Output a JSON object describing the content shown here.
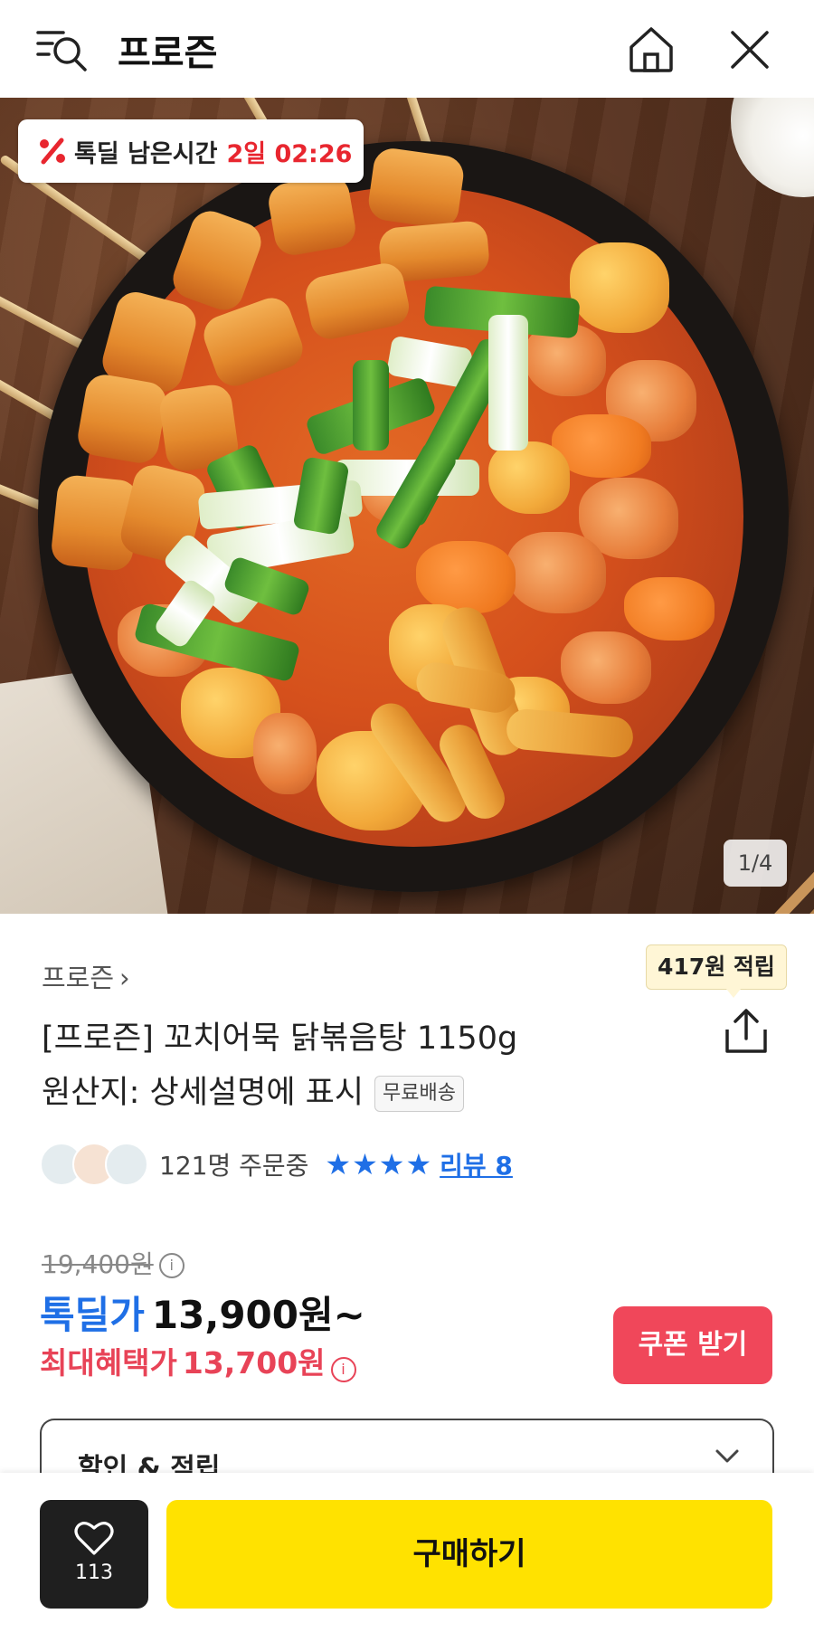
{
  "header": {
    "title": "프로즌",
    "icons": [
      "search-menu-icon",
      "home-icon",
      "close-icon"
    ]
  },
  "hero": {
    "deal_label": "톡딜 남은시간",
    "deal_time": "2일 02:26",
    "image_counter": "1/4"
  },
  "product": {
    "breadcrumb": "프로즌",
    "points_tooltip": "417원 적립",
    "title_line1": "[프로즌] 꼬치어묵 닭볶음탕 1150g",
    "title_line2": "원산지: 상세설명에 표시",
    "free_shipping": "무료배송",
    "order_count": "121명 주문중",
    "stars": "★★★★",
    "review_link": "리뷰 8"
  },
  "price": {
    "original": "19,400원",
    "deal_label": "톡딜가",
    "deal_price": "13,900원~",
    "max_benefit_label": "최대혜택가",
    "max_benefit_price": "13,700원",
    "coupon_button": "쿠폰 받기"
  },
  "discount_panel": {
    "label": "할인 & 적립"
  },
  "bottom_bar": {
    "like_count": "113",
    "buy_button": "구매하기"
  },
  "colors": {
    "deal_blue": "#1f6fe6",
    "benefit_red": "#e84357",
    "timer_red": "#e8262f",
    "buy_yellow": "#ffe200",
    "coupon_red": "#f0475a"
  }
}
